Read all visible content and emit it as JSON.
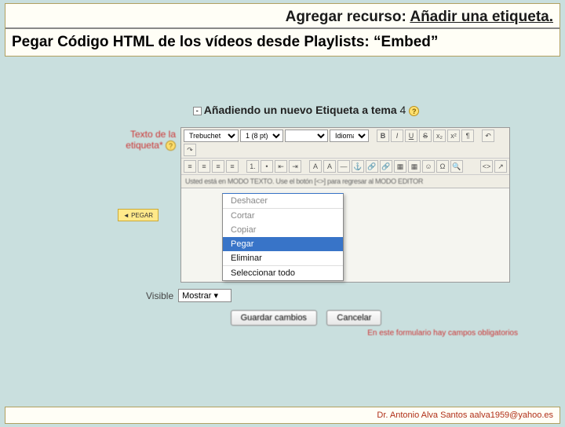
{
  "header": {
    "title_prefix": "Agregar recurso: ",
    "title_underlined": "Añadir una etiqueta.",
    "subtitle": "Pegar Código HTML de los vídeos desde Playlists: “Embed”"
  },
  "form": {
    "heading_prefix": "Añadiendo un nuevo Etiqueta a tema ",
    "heading_num": "4",
    "label_text": "Texto de la etiqueta*",
    "mode_msg": "Usted está en MODO TEXTO. Use el botón [<>] para regresar al MODO EDITOR",
    "visible_label": "Visible",
    "visible_value": "Mostrar",
    "save_btn": "Guardar cambios",
    "cancel_btn": "Cancelar",
    "required_msg": "En este formulario hay campos obligatorios",
    "hint_box": "◄ PEGAR"
  },
  "toolbar": {
    "font_family": "Trebuchet",
    "font_size": "1 (8 pt)",
    "style": " ",
    "lang": "Idioma",
    "bold": "B",
    "italic": "I",
    "underline": "U",
    "strike": "S",
    "code_toggle": "<>",
    "fullscreen": "↗"
  },
  "context_menu": {
    "undo": "Deshacer",
    "cut": "Cortar",
    "copy": "Copiar",
    "paste": "Pegar",
    "delete": "Eliminar",
    "select_all": "Seleccionar todo"
  },
  "footer": {
    "text": "Dr. Antonio Alva Santos  aalva1959@yahoo.es"
  }
}
